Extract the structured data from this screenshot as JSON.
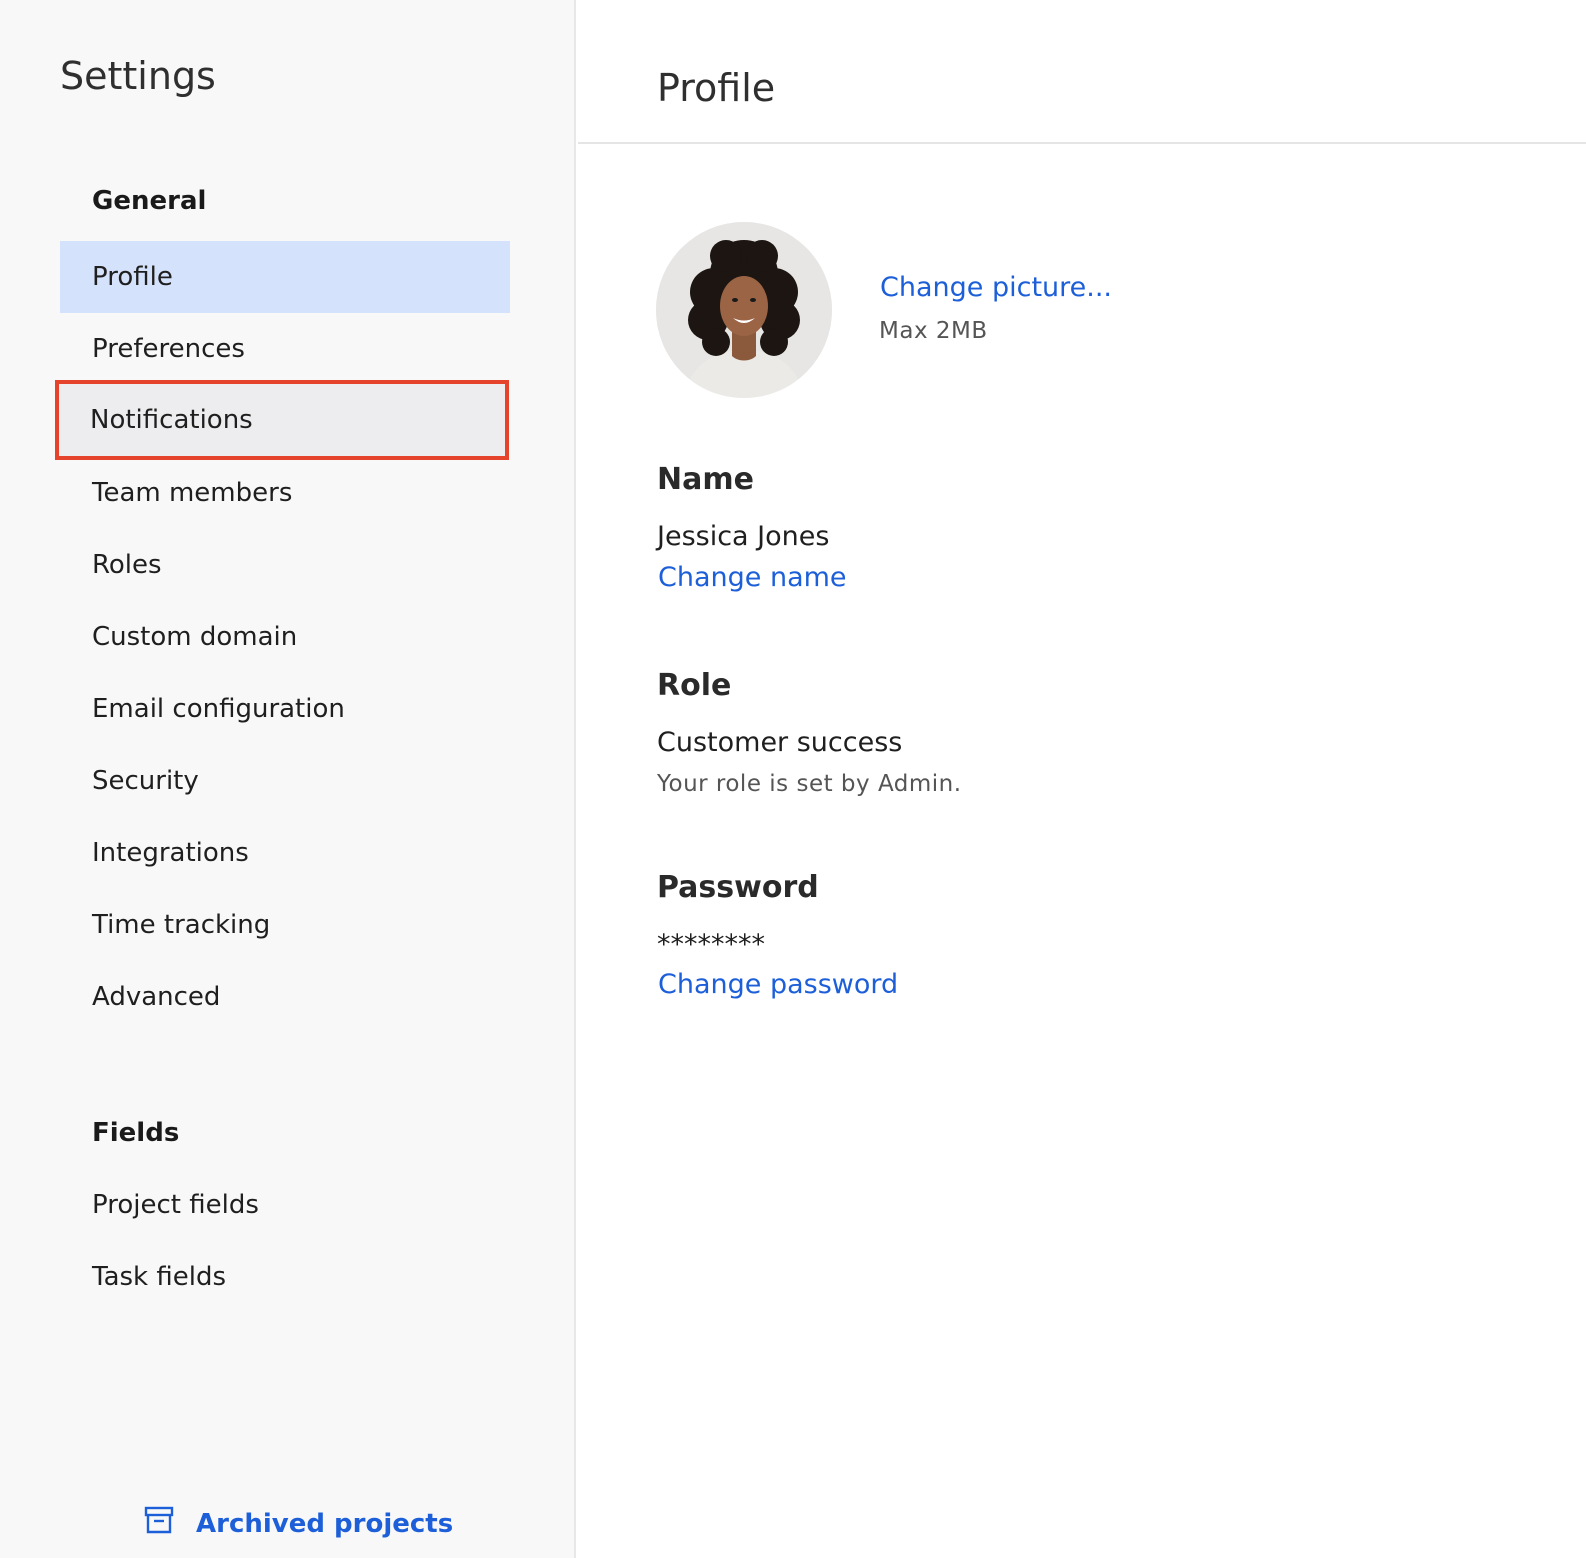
{
  "sidebar": {
    "title": "Settings",
    "sections": [
      {
        "heading": "General",
        "items": [
          {
            "label": "Profile"
          },
          {
            "label": "Preferences"
          },
          {
            "label": "Notifications"
          },
          {
            "label": "Team members"
          },
          {
            "label": "Roles"
          },
          {
            "label": "Custom domain"
          },
          {
            "label": "Email configuration"
          },
          {
            "label": "Security"
          },
          {
            "label": "Integrations"
          },
          {
            "label": "Time tracking"
          },
          {
            "label": "Advanced"
          }
        ]
      },
      {
        "heading": "Fields",
        "items": [
          {
            "label": "Project fields"
          },
          {
            "label": "Task fields"
          }
        ]
      }
    ],
    "active_item": "Profile",
    "highlighted_item": "Notifications",
    "footer_link": {
      "label": "Archived projects",
      "icon": "archive-box-icon"
    }
  },
  "main": {
    "title": "Profile",
    "picture": {
      "change_label": "Change picture...",
      "hint": "Max 2MB"
    },
    "name": {
      "label": "Name",
      "value": "Jessica Jones",
      "action": "Change name"
    },
    "role": {
      "label": "Role",
      "value": "Customer success",
      "help": "Your role is set by Admin."
    },
    "password": {
      "label": "Password",
      "value": "********",
      "action": "Change password"
    }
  },
  "colors": {
    "accent_link": "#1d5fd8",
    "active_nav_bg": "#d5e2fb",
    "highlight_outline": "#e5432c",
    "sidebar_bg": "#f8f8f8"
  }
}
